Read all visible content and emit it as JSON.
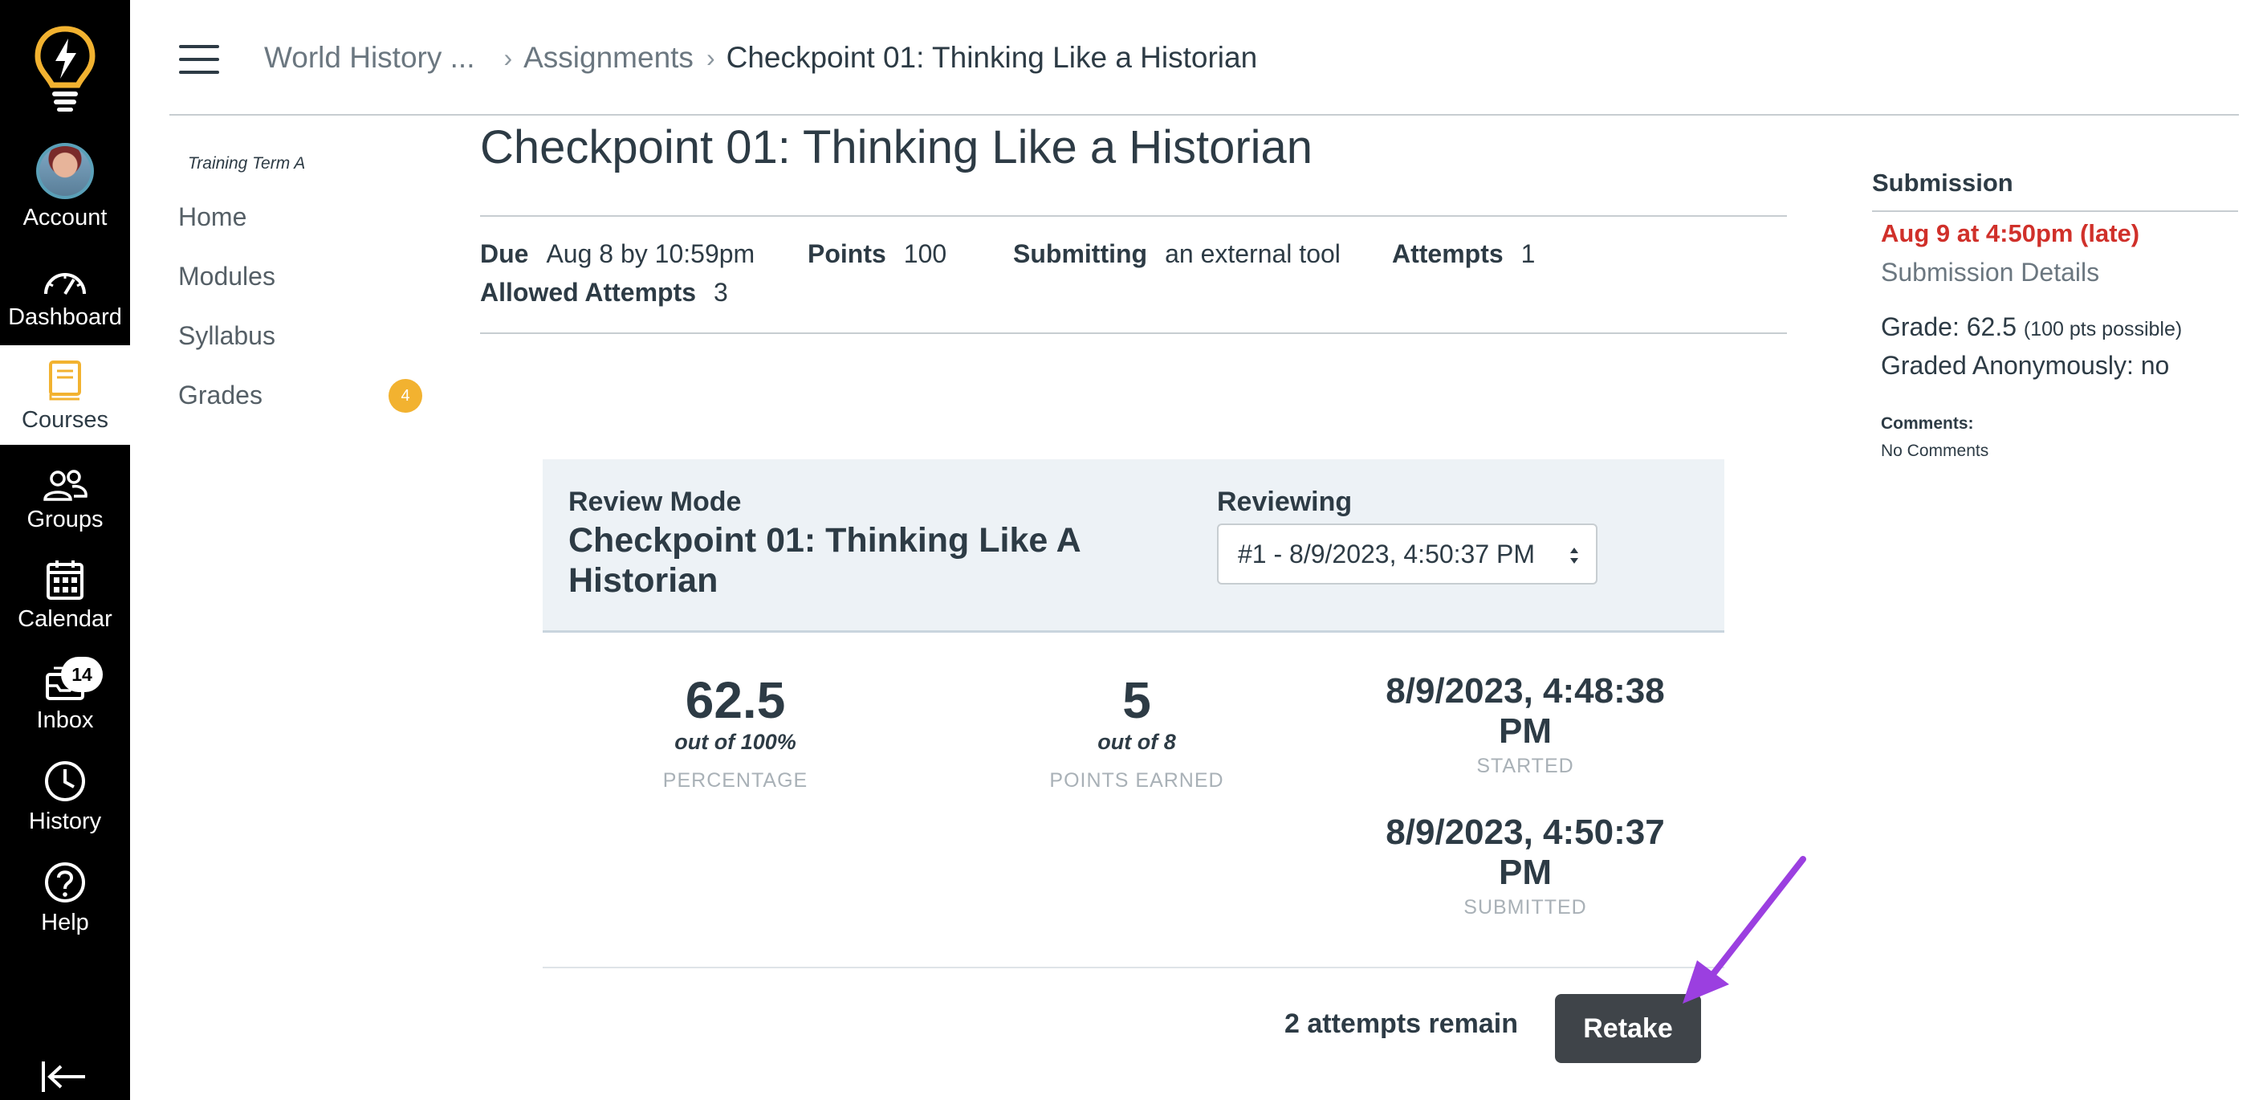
{
  "global_nav": {
    "items": [
      {
        "label": "Account",
        "icon": "avatar"
      },
      {
        "label": "Dashboard",
        "icon": "dashboard-icon"
      },
      {
        "label": "Courses",
        "icon": "courses-icon"
      },
      {
        "label": "Groups",
        "icon": "groups-icon"
      },
      {
        "label": "Calendar",
        "icon": "calendar-icon"
      },
      {
        "label": "Inbox",
        "icon": "inbox-icon"
      },
      {
        "label": "History",
        "icon": "history-icon"
      },
      {
        "label": "Help",
        "icon": "help-icon"
      }
    ],
    "inbox_count": "14",
    "accent_color": "#f2b230"
  },
  "breadcrumb": {
    "course": "World History ...",
    "section": "Assignments",
    "current": "Checkpoint 01: Thinking Like a Historian"
  },
  "course_nav": {
    "term": "Training Term A",
    "items": [
      "Home",
      "Modules",
      "Syllabus",
      "Grades"
    ],
    "grades_badge": "4"
  },
  "assignment": {
    "title": "Checkpoint 01: Thinking Like a Historian",
    "due_label": "Due",
    "due_value": "Aug 8 by 10:59pm",
    "points_label": "Points",
    "points_value": "100",
    "submitting_label": "Submitting",
    "submitting_value": "an external tool",
    "attempts_label": "Attempts",
    "attempts_value": "1",
    "allowed_label": "Allowed Attempts",
    "allowed_value": "3"
  },
  "review": {
    "mode_label": "Review Mode",
    "mode_title": "Checkpoint 01: Thinking Like A Historian",
    "reviewing_label": "Reviewing",
    "reviewing_selected": "#1 - 8/9/2023, 4:50:37 PM",
    "percentage": "62.5",
    "percentage_sub": "out of 100%",
    "percentage_caption": "PERCENTAGE",
    "points": "5",
    "points_sub": "out of 8",
    "points_caption": "POINTS EARNED",
    "started_line1": "8/9/2023, 4:48:38",
    "started_line2": "PM",
    "started_caption": "STARTED",
    "submitted_line1": "8/9/2023, 4:50:37",
    "submitted_line2": "PM",
    "submitted_caption": "SUBMITTED",
    "attempts_remain": "2 attempts remain",
    "retake_label": "Retake"
  },
  "submission": {
    "title": "Submission",
    "late_text": "Aug 9 at 4:50pm (late)",
    "details_link": "Submission Details",
    "grade_text": "Grade: 62.5",
    "grade_possible": "(100 pts possible)",
    "anonymous_text": "Graded Anonymously: no",
    "comments_label": "Comments:",
    "comments_value": "No Comments",
    "late_color": "#d0302a"
  },
  "annotation": {
    "arrow_color": "#9b3fe0"
  }
}
